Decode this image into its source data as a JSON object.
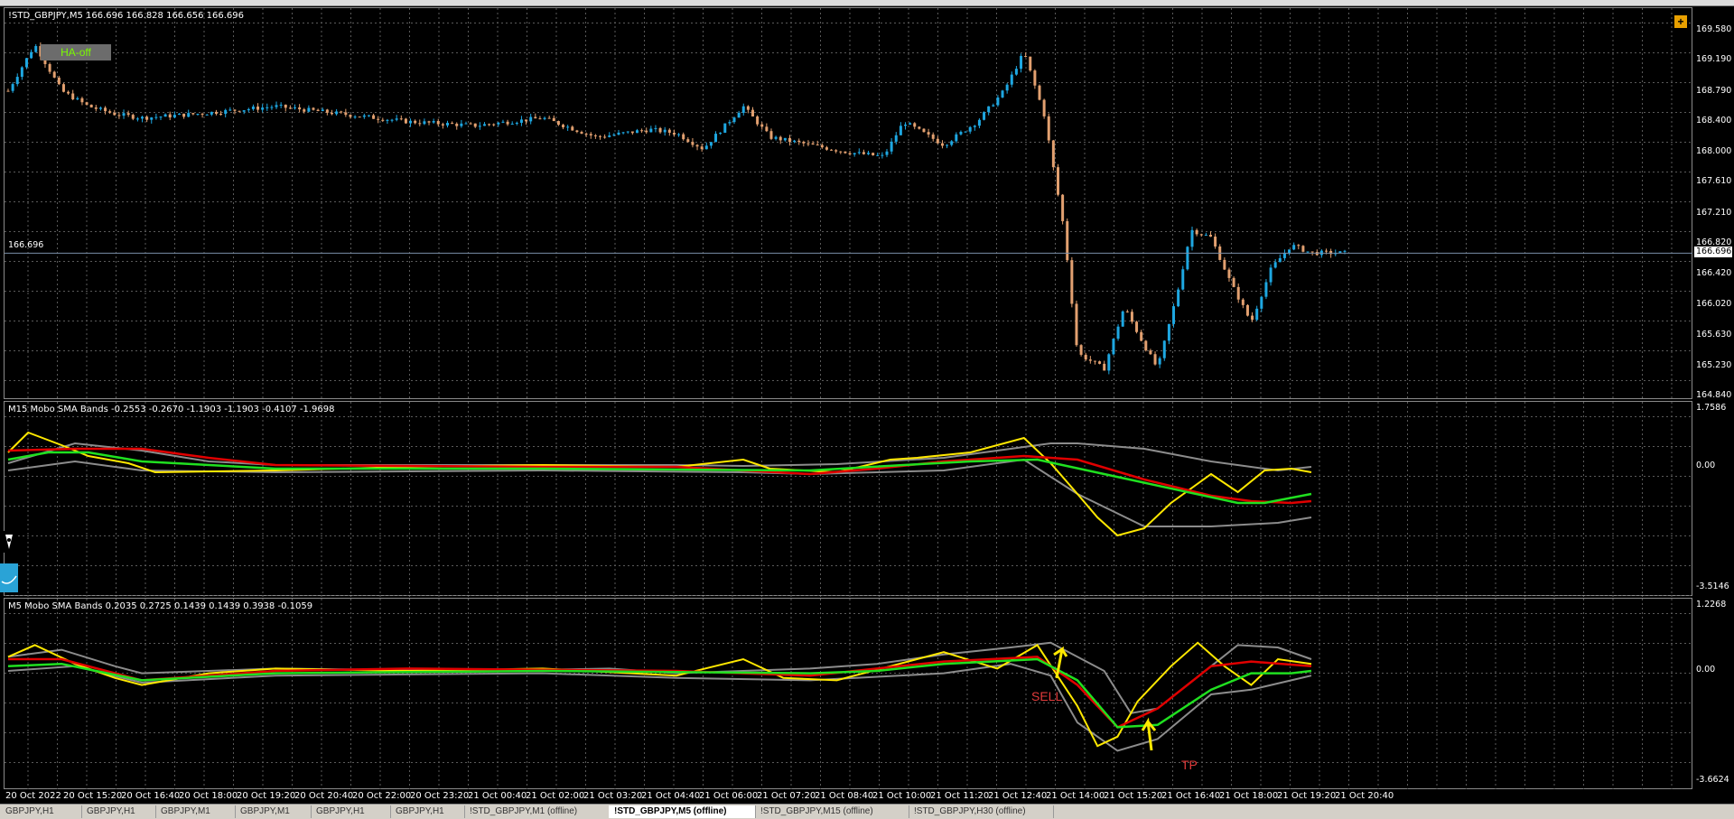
{
  "window": {
    "symbol_title": "!STD_GBPJPY,M5  166.696 166.828 166.656 166.696",
    "ha_button": "HA-off",
    "current_price": "166.696",
    "current_price_left": "166.696"
  },
  "price_axis": [
    "169.580",
    "169.190",
    "168.790",
    "168.400",
    "168.000",
    "167.610",
    "167.210",
    "166.820",
    "166.420",
    "166.020",
    "165.630",
    "165.230",
    "164.840"
  ],
  "indicators": {
    "m15": {
      "title": "M15 Mobo SMA Bands -0.2553 -0.2670 -1.1903 -1.1903 -0.4107 -1.9698",
      "axis": [
        "1.7586",
        "0.00",
        "-3.5146"
      ]
    },
    "m5": {
      "title": "M5 Mobo SMA Bands 0.2035 0.2725 0.1439 0.1439 0.3938 -0.1059",
      "axis": [
        "1.2268",
        "0.00",
        "-3.6624"
      ],
      "annotations": {
        "sell": "SELL",
        "tp": "TP"
      }
    }
  },
  "time_axis": [
    "20 Oct 2022",
    "20 Oct 15:20",
    "20 Oct 16:40",
    "20 Oct 18:00",
    "20 Oct 19:20",
    "20 Oct 20:40",
    "20 Oct 22:00",
    "20 Oct 23:20",
    "21 Oct 00:40",
    "21 Oct 02:00",
    "21 Oct 03:20",
    "21 Oct 04:40",
    "21 Oct 06:00",
    "21 Oct 07:20",
    "21 Oct 08:40",
    "21 Oct 10:00",
    "21 Oct 11:20",
    "21 Oct 12:40",
    "21 Oct 14:00",
    "21 Oct 15:20",
    "21 Oct 16:40",
    "21 Oct 18:00",
    "21 Oct 19:20",
    "21 Oct 20:40"
  ],
  "tabs": [
    {
      "label": "GBPJPY,H1"
    },
    {
      "label": "GBPJPY,H1"
    },
    {
      "label": "GBPJPY,M1"
    },
    {
      "label": "GBPJPY,M1"
    },
    {
      "label": "GBPJPY,H1"
    },
    {
      "label": "GBPJPY,H1"
    },
    {
      "label": "!STD_GBPJPY,M1 (offline)"
    },
    {
      "label": "!STD_GBPJPY,M5 (offline)"
    },
    {
      "label": "!STD_GBPJPY,M15 (offline)"
    },
    {
      "label": "!STD_GBPJPY,H30 (offline)"
    }
  ],
  "colors": {
    "bull": "#1ea7e1",
    "bear": "#e2a070",
    "grid": "#5a5a5a",
    "band_gray": "#8c8c8c",
    "signal_yellow": "#ffe800",
    "sma_red": "#e00000",
    "sma_green": "#20e020",
    "annot_red": "#e23b3b"
  },
  "chart_data": {
    "type": "candlestick",
    "ylim": [
      164.84,
      169.58
    ],
    "close_path": [
      [
        0,
        168.8
      ],
      [
        0.02,
        169.4
      ],
      [
        0.04,
        168.8
      ],
      [
        0.06,
        168.6
      ],
      [
        0.08,
        168.5
      ],
      [
        0.1,
        168.45
      ],
      [
        0.14,
        168.5
      ],
      [
        0.2,
        168.6
      ],
      [
        0.25,
        168.5
      ],
      [
        0.3,
        168.4
      ],
      [
        0.35,
        168.35
      ],
      [
        0.4,
        168.45
      ],
      [
        0.44,
        168.2
      ],
      [
        0.48,
        168.3
      ],
      [
        0.5,
        168.25
      ],
      [
        0.52,
        168.05
      ],
      [
        0.55,
        168.6
      ],
      [
        0.57,
        168.2
      ],
      [
        0.6,
        168.1
      ],
      [
        0.63,
        168.0
      ],
      [
        0.655,
        167.95
      ],
      [
        0.67,
        168.4
      ],
      [
        0.7,
        168.1
      ],
      [
        0.725,
        168.4
      ],
      [
        0.745,
        168.8
      ],
      [
        0.76,
        169.3
      ],
      [
        0.775,
        168.5
      ],
      [
        0.79,
        167.0
      ],
      [
        0.8,
        165.4
      ],
      [
        0.82,
        165.2
      ],
      [
        0.835,
        166.0
      ],
      [
        0.85,
        165.5
      ],
      [
        0.86,
        165.2
      ],
      [
        0.875,
        166.2
      ],
      [
        0.885,
        167.0
      ],
      [
        0.9,
        166.9
      ],
      [
        0.915,
        166.3
      ],
      [
        0.93,
        165.8
      ],
      [
        0.945,
        166.5
      ],
      [
        0.96,
        166.8
      ],
      [
        0.975,
        166.7
      ]
    ]
  }
}
